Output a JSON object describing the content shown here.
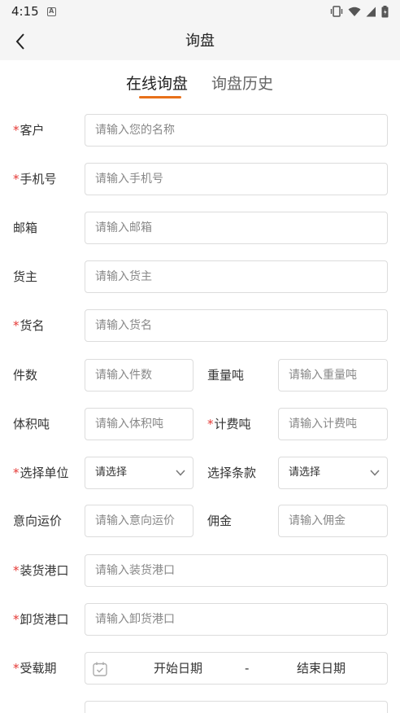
{
  "status_bar": {
    "time": "4:15",
    "app_icon": "A"
  },
  "nav": {
    "title": "询盘",
    "back_icon": "chevron-left-icon"
  },
  "tabs": [
    {
      "label": "在线询盘",
      "active": true
    },
    {
      "label": "询盘历史",
      "active": false
    }
  ],
  "form": {
    "customer": {
      "label": "客户",
      "required": "*",
      "placeholder": "请输入您的名称"
    },
    "phone": {
      "label": "手机号",
      "required": "*",
      "placeholder": "请输入手机号"
    },
    "email": {
      "label": "邮箱",
      "placeholder": "请输入邮箱"
    },
    "owner": {
      "label": "货主",
      "placeholder": "请输入货主"
    },
    "cargo_name": {
      "label": "货名",
      "required": "*",
      "placeholder": "请输入货名"
    },
    "pieces": {
      "label": "件数",
      "placeholder": "请输入件数"
    },
    "weight_ton": {
      "label": "重量吨",
      "placeholder": "请输入重量吨"
    },
    "volume_ton": {
      "label": "体积吨",
      "placeholder": "请输入体积吨"
    },
    "billing_ton": {
      "label": "计费吨",
      "required": "*",
      "placeholder": "请输入计费吨"
    },
    "unit": {
      "label": "选择单位",
      "required": "*",
      "value": "请选择"
    },
    "terms": {
      "label": "选择条款",
      "value": "请选择"
    },
    "intended_freight": {
      "label": "意向运价",
      "placeholder": "请输入意向运价"
    },
    "commission": {
      "label": "佣金",
      "placeholder": "请输入佣金"
    },
    "loading_port": {
      "label": "装货港口",
      "required": "*",
      "placeholder": "请输入装货港口"
    },
    "unloading_port": {
      "label": "卸货港口",
      "required": "*",
      "placeholder": "请输入卸货港口"
    },
    "laycan": {
      "label": "受载期",
      "required": "*",
      "start": "开始日期",
      "separator": "-",
      "end": "结束日期"
    }
  },
  "colors": {
    "accent": "#e8701a",
    "required": "#e53935",
    "border": "#dcdcdc",
    "bar_bg": "#f5f5f5"
  }
}
